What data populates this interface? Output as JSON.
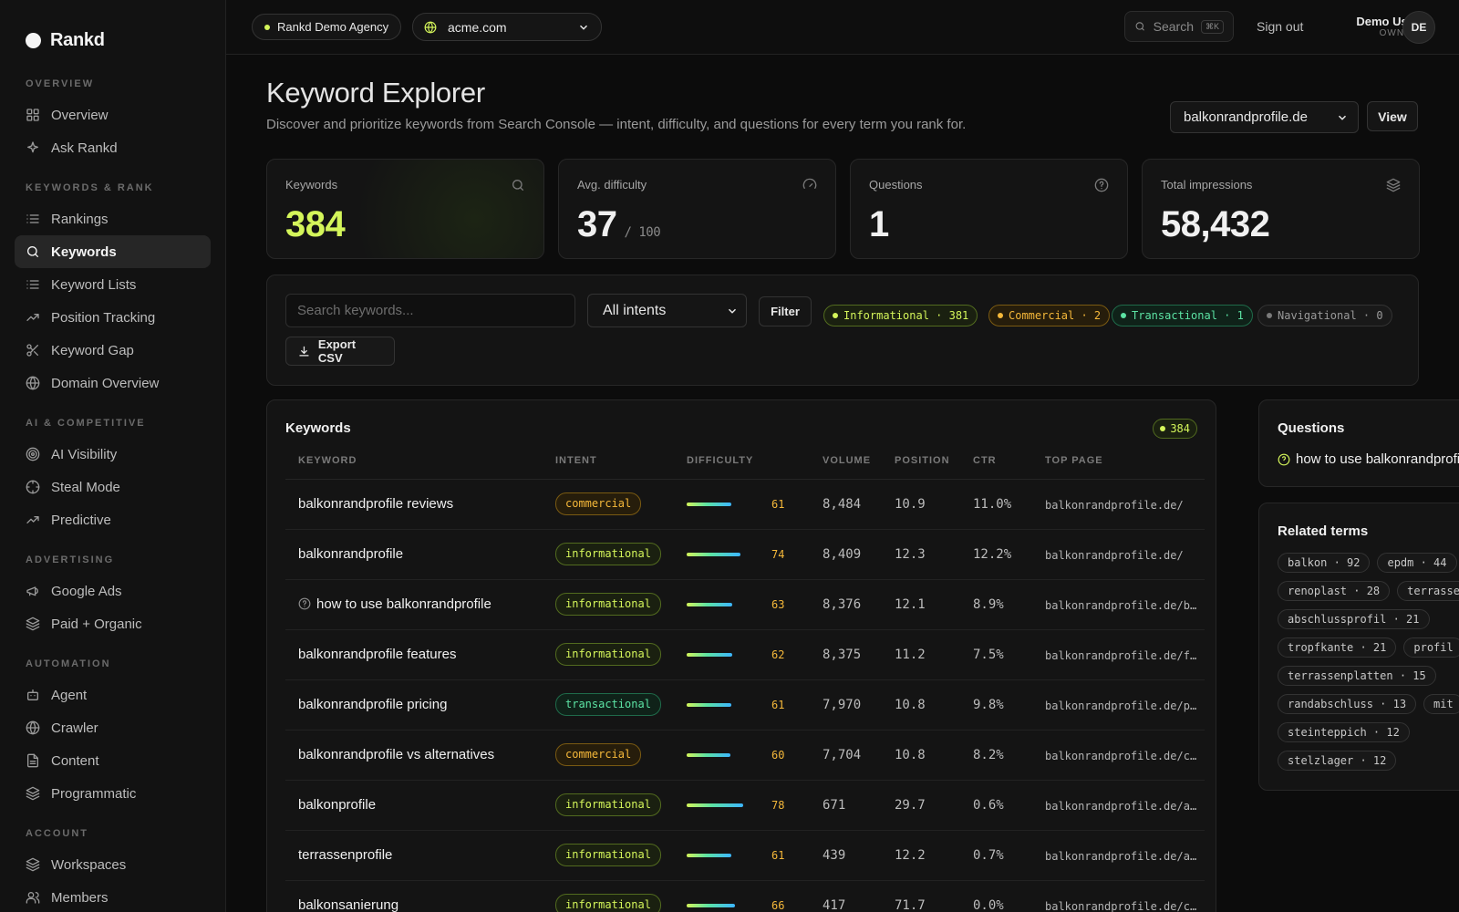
{
  "brand": {
    "name": "Rankd"
  },
  "sidebar": {
    "sections": [
      {
        "heading": "OVERVIEW",
        "items": [
          {
            "label": "Overview",
            "icon": "grid-icon"
          },
          {
            "label": "Ask Rankd",
            "icon": "sparkle-icon"
          }
        ]
      },
      {
        "heading": "KEYWORDS & RANK",
        "items": [
          {
            "label": "Rankings",
            "icon": "list-icon"
          },
          {
            "label": "Keywords",
            "icon": "search-icon",
            "active": true
          },
          {
            "label": "Keyword Lists",
            "icon": "list-icon"
          },
          {
            "label": "Position Tracking",
            "icon": "trend-icon"
          },
          {
            "label": "Keyword Gap",
            "icon": "scissors-icon"
          },
          {
            "label": "Domain Overview",
            "icon": "globe-icon"
          }
        ]
      },
      {
        "heading": "AI & COMPETITIVE",
        "items": [
          {
            "label": "AI Visibility",
            "icon": "radar-icon"
          },
          {
            "label": "Steal Mode",
            "icon": "crosshair-icon"
          },
          {
            "label": "Predictive",
            "icon": "trend-icon"
          }
        ]
      },
      {
        "heading": "ADVERTISING",
        "items": [
          {
            "label": "Google Ads",
            "icon": "megaphone-icon"
          },
          {
            "label": "Paid + Organic",
            "icon": "layers-icon"
          }
        ]
      },
      {
        "heading": "AUTOMATION",
        "items": [
          {
            "label": "Agent",
            "icon": "bot-icon"
          },
          {
            "label": "Crawler",
            "icon": "globe-icon"
          },
          {
            "label": "Content",
            "icon": "document-icon"
          },
          {
            "label": "Programmatic",
            "icon": "layers-icon"
          }
        ]
      },
      {
        "heading": "ACCOUNT",
        "items": [
          {
            "label": "Workspaces",
            "icon": "layers-icon"
          },
          {
            "label": "Members",
            "icon": "users-icon"
          }
        ]
      }
    ]
  },
  "topbar": {
    "agency": "Rankd Demo Agency",
    "domain": "acme.com",
    "search_label": "Search",
    "search_shortcut": "⌘K",
    "signout": "Sign out",
    "user_name": "Demo User",
    "user_role": "OWNER",
    "user_initials": "DE"
  },
  "page": {
    "title": "Keyword Explorer",
    "subtitle": "Discover and prioritize keywords from Search Console — intent, difficulty, and questions for every term you rank for.",
    "site": "balkonrandprofile.de",
    "view_label": "View"
  },
  "stats": [
    {
      "label": "Keywords",
      "value": "384",
      "suffix": "",
      "icon": "search-icon"
    },
    {
      "label": "Avg. difficulty",
      "value": "37",
      "suffix": "/ 100",
      "icon": "gauge-icon"
    },
    {
      "label": "Questions",
      "value": "1",
      "suffix": "",
      "icon": "help-circle-icon"
    },
    {
      "label": "Total impressions",
      "value": "58,432",
      "suffix": "",
      "icon": "layers-icon"
    }
  ],
  "filters": {
    "search_placeholder": "Search keywords...",
    "intent_selected": "All intents",
    "filter_label": "Filter",
    "chips": [
      {
        "label": "Informational · 381",
        "kind": "info"
      },
      {
        "label": "Commercial · 2",
        "kind": "comm"
      },
      {
        "label": "Transactional · 1",
        "kind": "trans"
      },
      {
        "label": "Navigational · 0",
        "kind": "nav"
      }
    ],
    "export_label": "Export CSV"
  },
  "keywords_table": {
    "title": "Keywords",
    "count": "384",
    "columns": [
      "KEYWORD",
      "INTENT",
      "DIFFICULTY",
      "VOLUME",
      "POSITION",
      "CTR",
      "TOP PAGE"
    ],
    "rows": [
      {
        "keyword": "balkonrandprofile reviews",
        "intent": "commercial",
        "difficulty": 61,
        "volume": "8,484",
        "position": "10.9",
        "ctr": "11.0%",
        "top_page": "balkonrandprofile.de/"
      },
      {
        "keyword": "balkonrandprofile",
        "intent": "informational",
        "difficulty": 74,
        "volume": "8,409",
        "position": "12.3",
        "ctr": "12.2%",
        "top_page": "balkonrandprofile.de/"
      },
      {
        "keyword": "how to use balkonrandprofile",
        "intent": "informational",
        "difficulty": 63,
        "volume": "8,376",
        "position": "12.1",
        "ctr": "8.9%",
        "top_page": "balkonrandprofile.de/b…",
        "question": true
      },
      {
        "keyword": "balkonrandprofile features",
        "intent": "informational",
        "difficulty": 62,
        "volume": "8,375",
        "position": "11.2",
        "ctr": "7.5%",
        "top_page": "balkonrandprofile.de/f…"
      },
      {
        "keyword": "balkonrandprofile pricing",
        "intent": "transactional",
        "difficulty": 61,
        "volume": "7,970",
        "position": "10.8",
        "ctr": "9.8%",
        "top_page": "balkonrandprofile.de/p…"
      },
      {
        "keyword": "balkonrandprofile vs alternatives",
        "intent": "commercial",
        "difficulty": 60,
        "volume": "7,704",
        "position": "10.8",
        "ctr": "8.2%",
        "top_page": "balkonrandprofile.de/c…"
      },
      {
        "keyword": "balkonprofile",
        "intent": "informational",
        "difficulty": 78,
        "volume": "671",
        "position": "29.7",
        "ctr": "0.6%",
        "top_page": "balkonrandprofile.de/a…"
      },
      {
        "keyword": "terrassenprofile",
        "intent": "informational",
        "difficulty": 61,
        "volume": "439",
        "position": "12.2",
        "ctr": "0.7%",
        "top_page": "balkonrandprofile.de/a…"
      },
      {
        "keyword": "balkonsanierung",
        "intent": "informational",
        "difficulty": 66,
        "volume": "417",
        "position": "71.7",
        "ctr": "0.0%",
        "top_page": "balkonrandprofile.de/c…"
      }
    ]
  },
  "questions": {
    "title": "Questions",
    "items": [
      "how to use balkonrandprofile"
    ]
  },
  "related": {
    "title": "Related terms",
    "rows": [
      [
        "balkon · 92",
        "epdm · 44"
      ],
      [
        "renoplast · 28",
        "terrasse"
      ],
      [
        "abschlussprofil · 21"
      ],
      [
        "tropfkante · 21",
        "profil"
      ],
      [
        "terrassenplatten · 15"
      ],
      [
        "randabschluss · 13",
        "mit"
      ],
      [
        "steinteppich · 12"
      ],
      [
        "stelzlager · 12"
      ]
    ]
  }
}
